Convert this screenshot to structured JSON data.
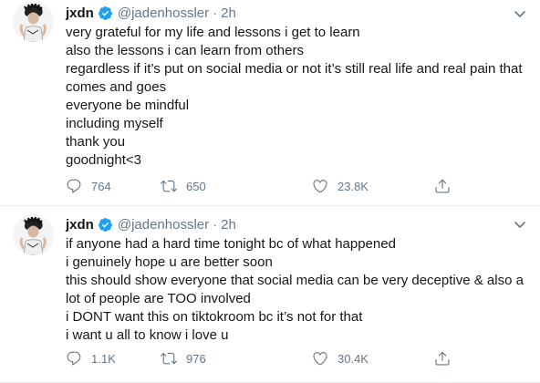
{
  "colors": {
    "text_primary": "#14171a",
    "text_secondary": "#657786",
    "verified_blue": "#1da1f2",
    "divider": "#e6ecf0"
  },
  "tweets": [
    {
      "display_name": "jxdn",
      "handle": "@jadenhossler",
      "separator": "·",
      "time": "2h",
      "lines": [
        "very grateful for my life and lessons i get to learn",
        "also the lessons i can learn from others",
        "regardless if it’s put on social media or not it’s still real life and real pain that",
        "comes and goes",
        "everyone be mindful",
        "including myself",
        "thank you",
        "goodnight<3"
      ],
      "replies": "764",
      "retweets": "650",
      "likes": "23.8K",
      "icons": [
        "reply-icon",
        "retweet-icon",
        "like-icon",
        "share-icon",
        "verified-icon",
        "caret-down-icon"
      ]
    },
    {
      "display_name": "jxdn",
      "handle": "@jadenhossler",
      "separator": "·",
      "time": "2h",
      "lines": [
        "if anyone had a hard time tonight bc of what happened",
        "i genuinely hope u are better soon",
        "this should show everyone that social media can be very deceptive & also a",
        "lot of people are TOO involved",
        "i DONT want this on tiktokroom bc it’s not for that",
        "i want u all to know i love u"
      ],
      "replies": "1.1K",
      "retweets": "976",
      "likes": "30.4K",
      "icons": [
        "reply-icon",
        "retweet-icon",
        "like-icon",
        "share-icon",
        "verified-icon",
        "caret-down-icon"
      ]
    }
  ]
}
